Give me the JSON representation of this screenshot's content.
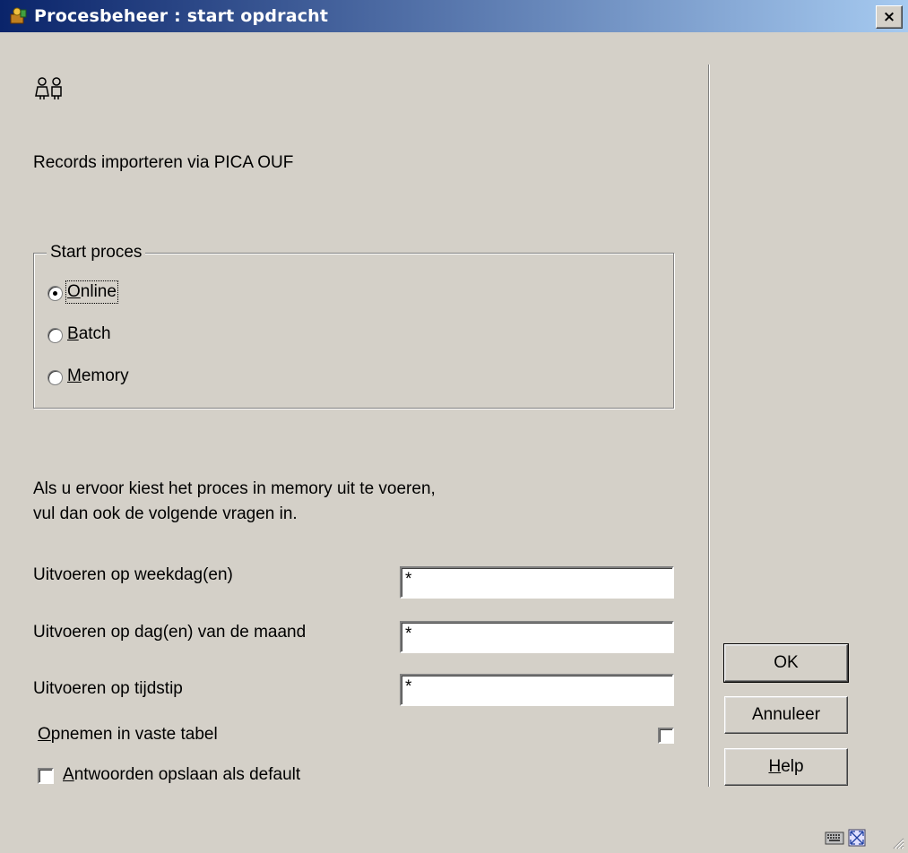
{
  "window": {
    "title": "Procesbeheer : start opdracht",
    "close_label": "×"
  },
  "main": {
    "header_icon": "users-icon",
    "description": "Records importeren via PICA OUF",
    "group": {
      "legend": "Start proces",
      "options": [
        {
          "accel": "O",
          "rest": "nline",
          "selected": true
        },
        {
          "accel": "B",
          "rest": "atch",
          "selected": false
        },
        {
          "accel": "M",
          "rest": "emory",
          "selected": false
        }
      ]
    },
    "memory_note_line1": "Als u ervoor kiest het proces in memory uit te voeren,",
    "memory_note_line2": "vul dan ook de volgende vragen in.",
    "fields": [
      {
        "label": "Uitvoeren op weekdag(en)",
        "value": "*"
      },
      {
        "label": "Uitvoeren op dag(en) van de maand",
        "value": "*"
      },
      {
        "label": "Uitvoeren op tijdstip",
        "value": "*"
      }
    ],
    "fixed_table": {
      "accel": "O",
      "rest": "pnemen in vaste tabel",
      "checked": false
    },
    "save_defaults": {
      "accel": "A",
      "rest": "ntwoorden opslaan als default",
      "checked": false
    }
  },
  "buttons": {
    "ok": "OK",
    "cancel": "Annuleer",
    "help_accel": "H",
    "help_rest": "elp"
  }
}
